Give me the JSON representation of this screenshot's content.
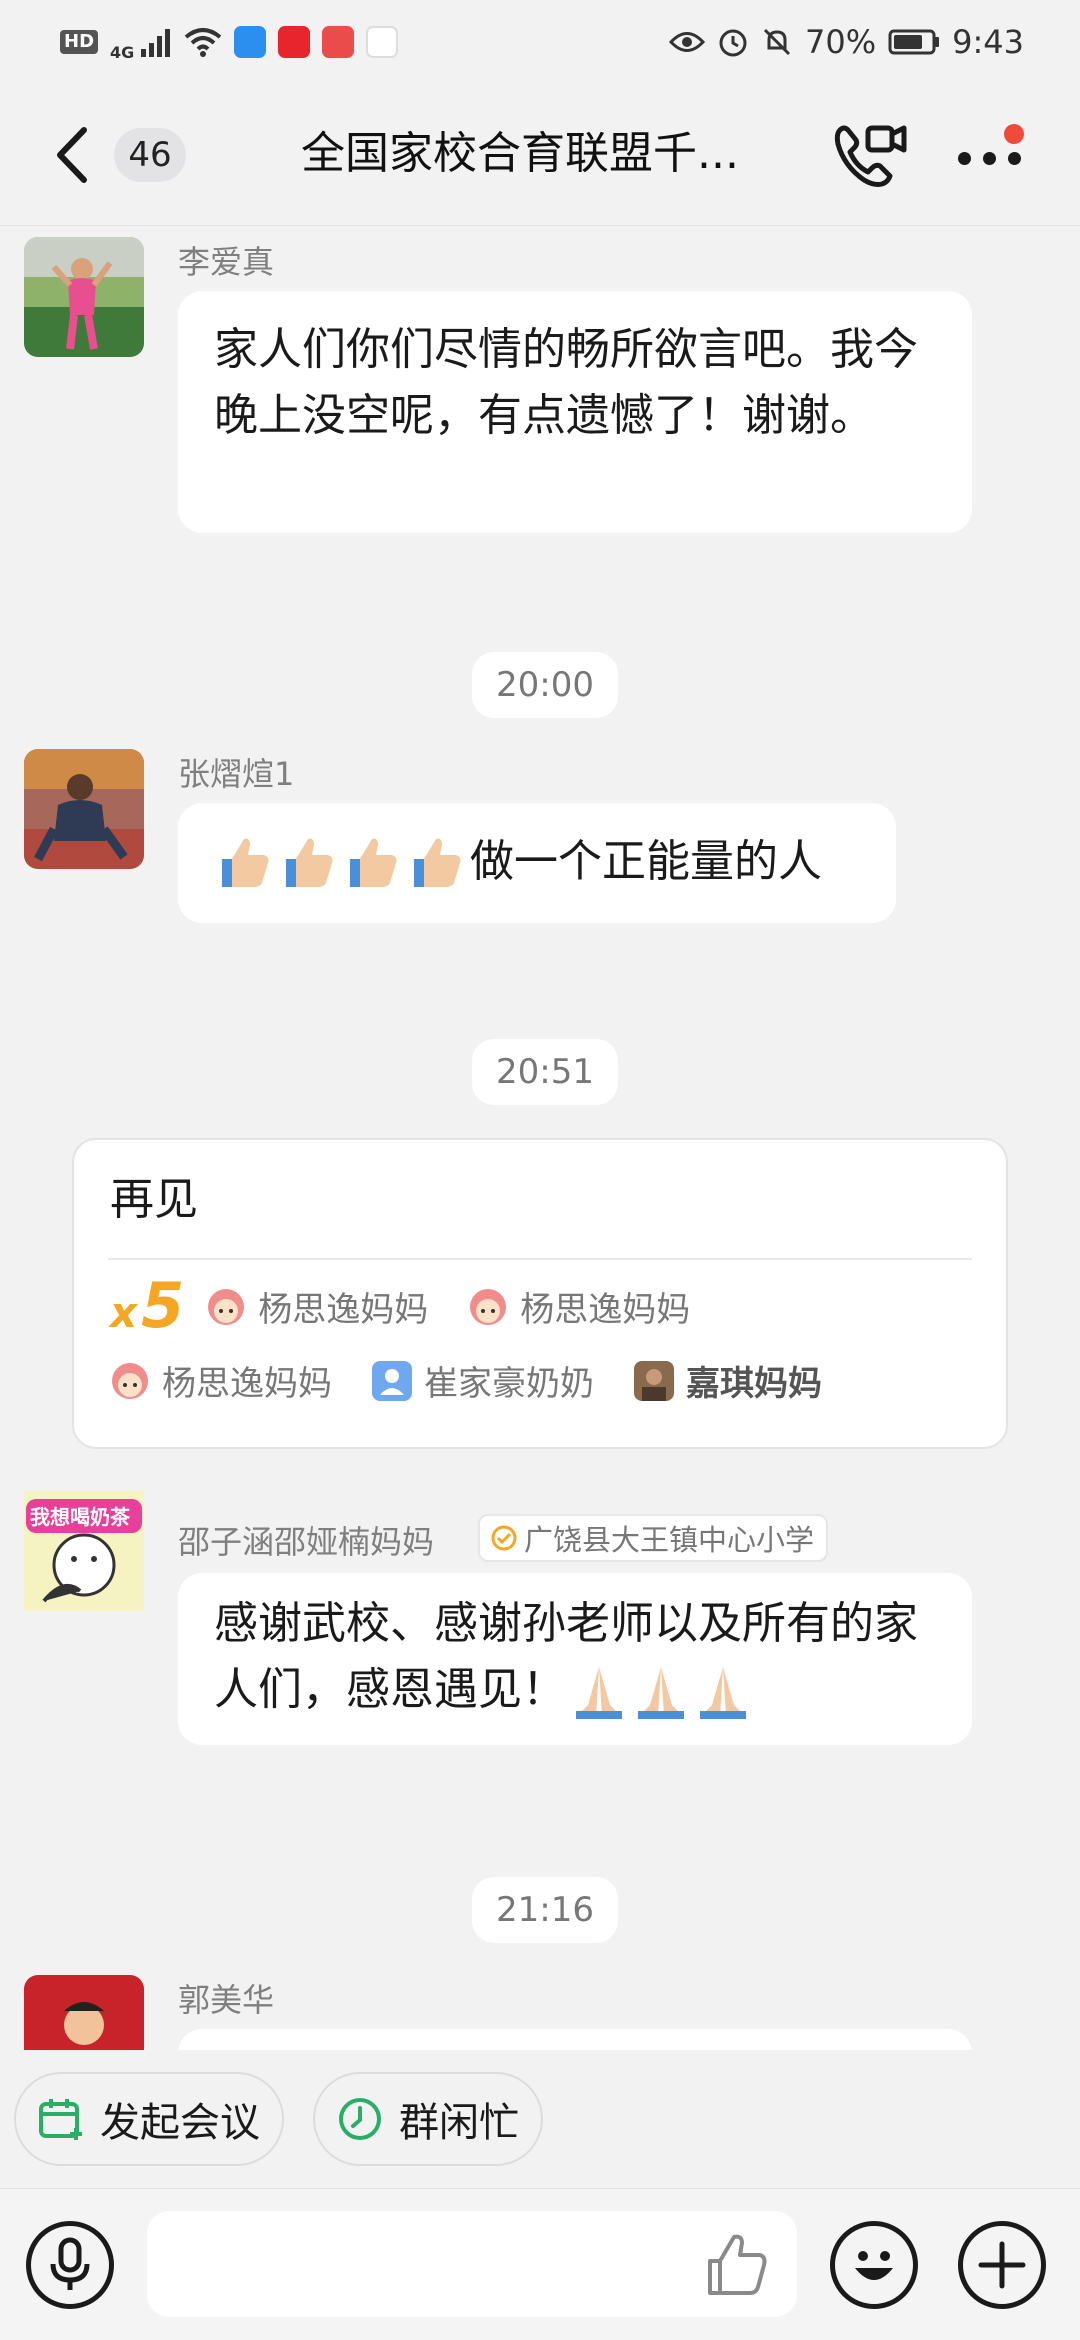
{
  "status_bar": {
    "left_icons": [
      "hd-icon",
      "4g-signal-icon",
      "wifi-icon",
      "dingtalk-icon",
      "news-app-icon",
      "book-app-icon",
      "fm-app-icon"
    ],
    "hd": "HD",
    "network": "4G",
    "battery": "70%",
    "time": "9:43",
    "right_icons": [
      "eye-icon",
      "alarm-icon",
      "mute-icon",
      "battery-icon"
    ]
  },
  "header": {
    "unread_count": "46",
    "title": "全国家校合育联盟千...",
    "has_notification_dot": true
  },
  "messages": [
    {
      "sender": "李爱真",
      "text": "家人们你们尽情的畅所欲言吧。我今晚上没空呢，有点遗憾了！谢谢。",
      "avatar": "woman-running-photo"
    },
    {
      "time": "20:00"
    },
    {
      "sender": "张熠煊1",
      "emoji": [
        "thumbs-up",
        "thumbs-up",
        "thumbs-up",
        "thumbs-up"
      ],
      "text": "做一个正能量的人",
      "avatar": "child-running-photo"
    },
    {
      "time": "20:51"
    },
    {
      "relay": {
        "text": "再见",
        "count_prefix": "x",
        "count": "5",
        "participants": [
          {
            "name": "杨思逸妈妈",
            "avatar": "cartoon-girl"
          },
          {
            "name": "杨思逸妈妈",
            "avatar": "cartoon-girl"
          },
          {
            "name": "杨思逸妈妈",
            "avatar": "cartoon-girl"
          },
          {
            "name": "崔家豪奶奶",
            "avatar": "default-person"
          },
          {
            "name": "嘉琪妈妈",
            "avatar": "photo"
          }
        ]
      }
    },
    {
      "sender": "邵子涵邵娅楠妈妈",
      "tag": "广饶县大王镇中心小学",
      "text": "感谢武校、感谢孙老师以及所有的家人们，感恩遇见！",
      "emoji_suffix": [
        "folded-hands",
        "folded-hands",
        "folded-hands"
      ],
      "avatar": "cartoon-bear-milk-tea",
      "avatar_text": "我想喝奶茶"
    },
    {
      "time": "21:16"
    },
    {
      "sender": "郭美华",
      "avatar": "child-photo-red"
    }
  ],
  "quick_actions": [
    {
      "label": "发起会议",
      "icon": "calendar-plus-icon"
    },
    {
      "label": "群闲忙",
      "icon": "clock-icon"
    }
  ],
  "input_bar": {
    "placeholder": "",
    "icons": [
      "microphone-icon",
      "thumbs-up-icon",
      "emoji-icon",
      "plus-icon"
    ]
  },
  "colors": {
    "background": "#f2f2f3",
    "accent_green": "#2aae67",
    "relay_count": "#f5a623",
    "notification_dot": "#f04b3a"
  }
}
